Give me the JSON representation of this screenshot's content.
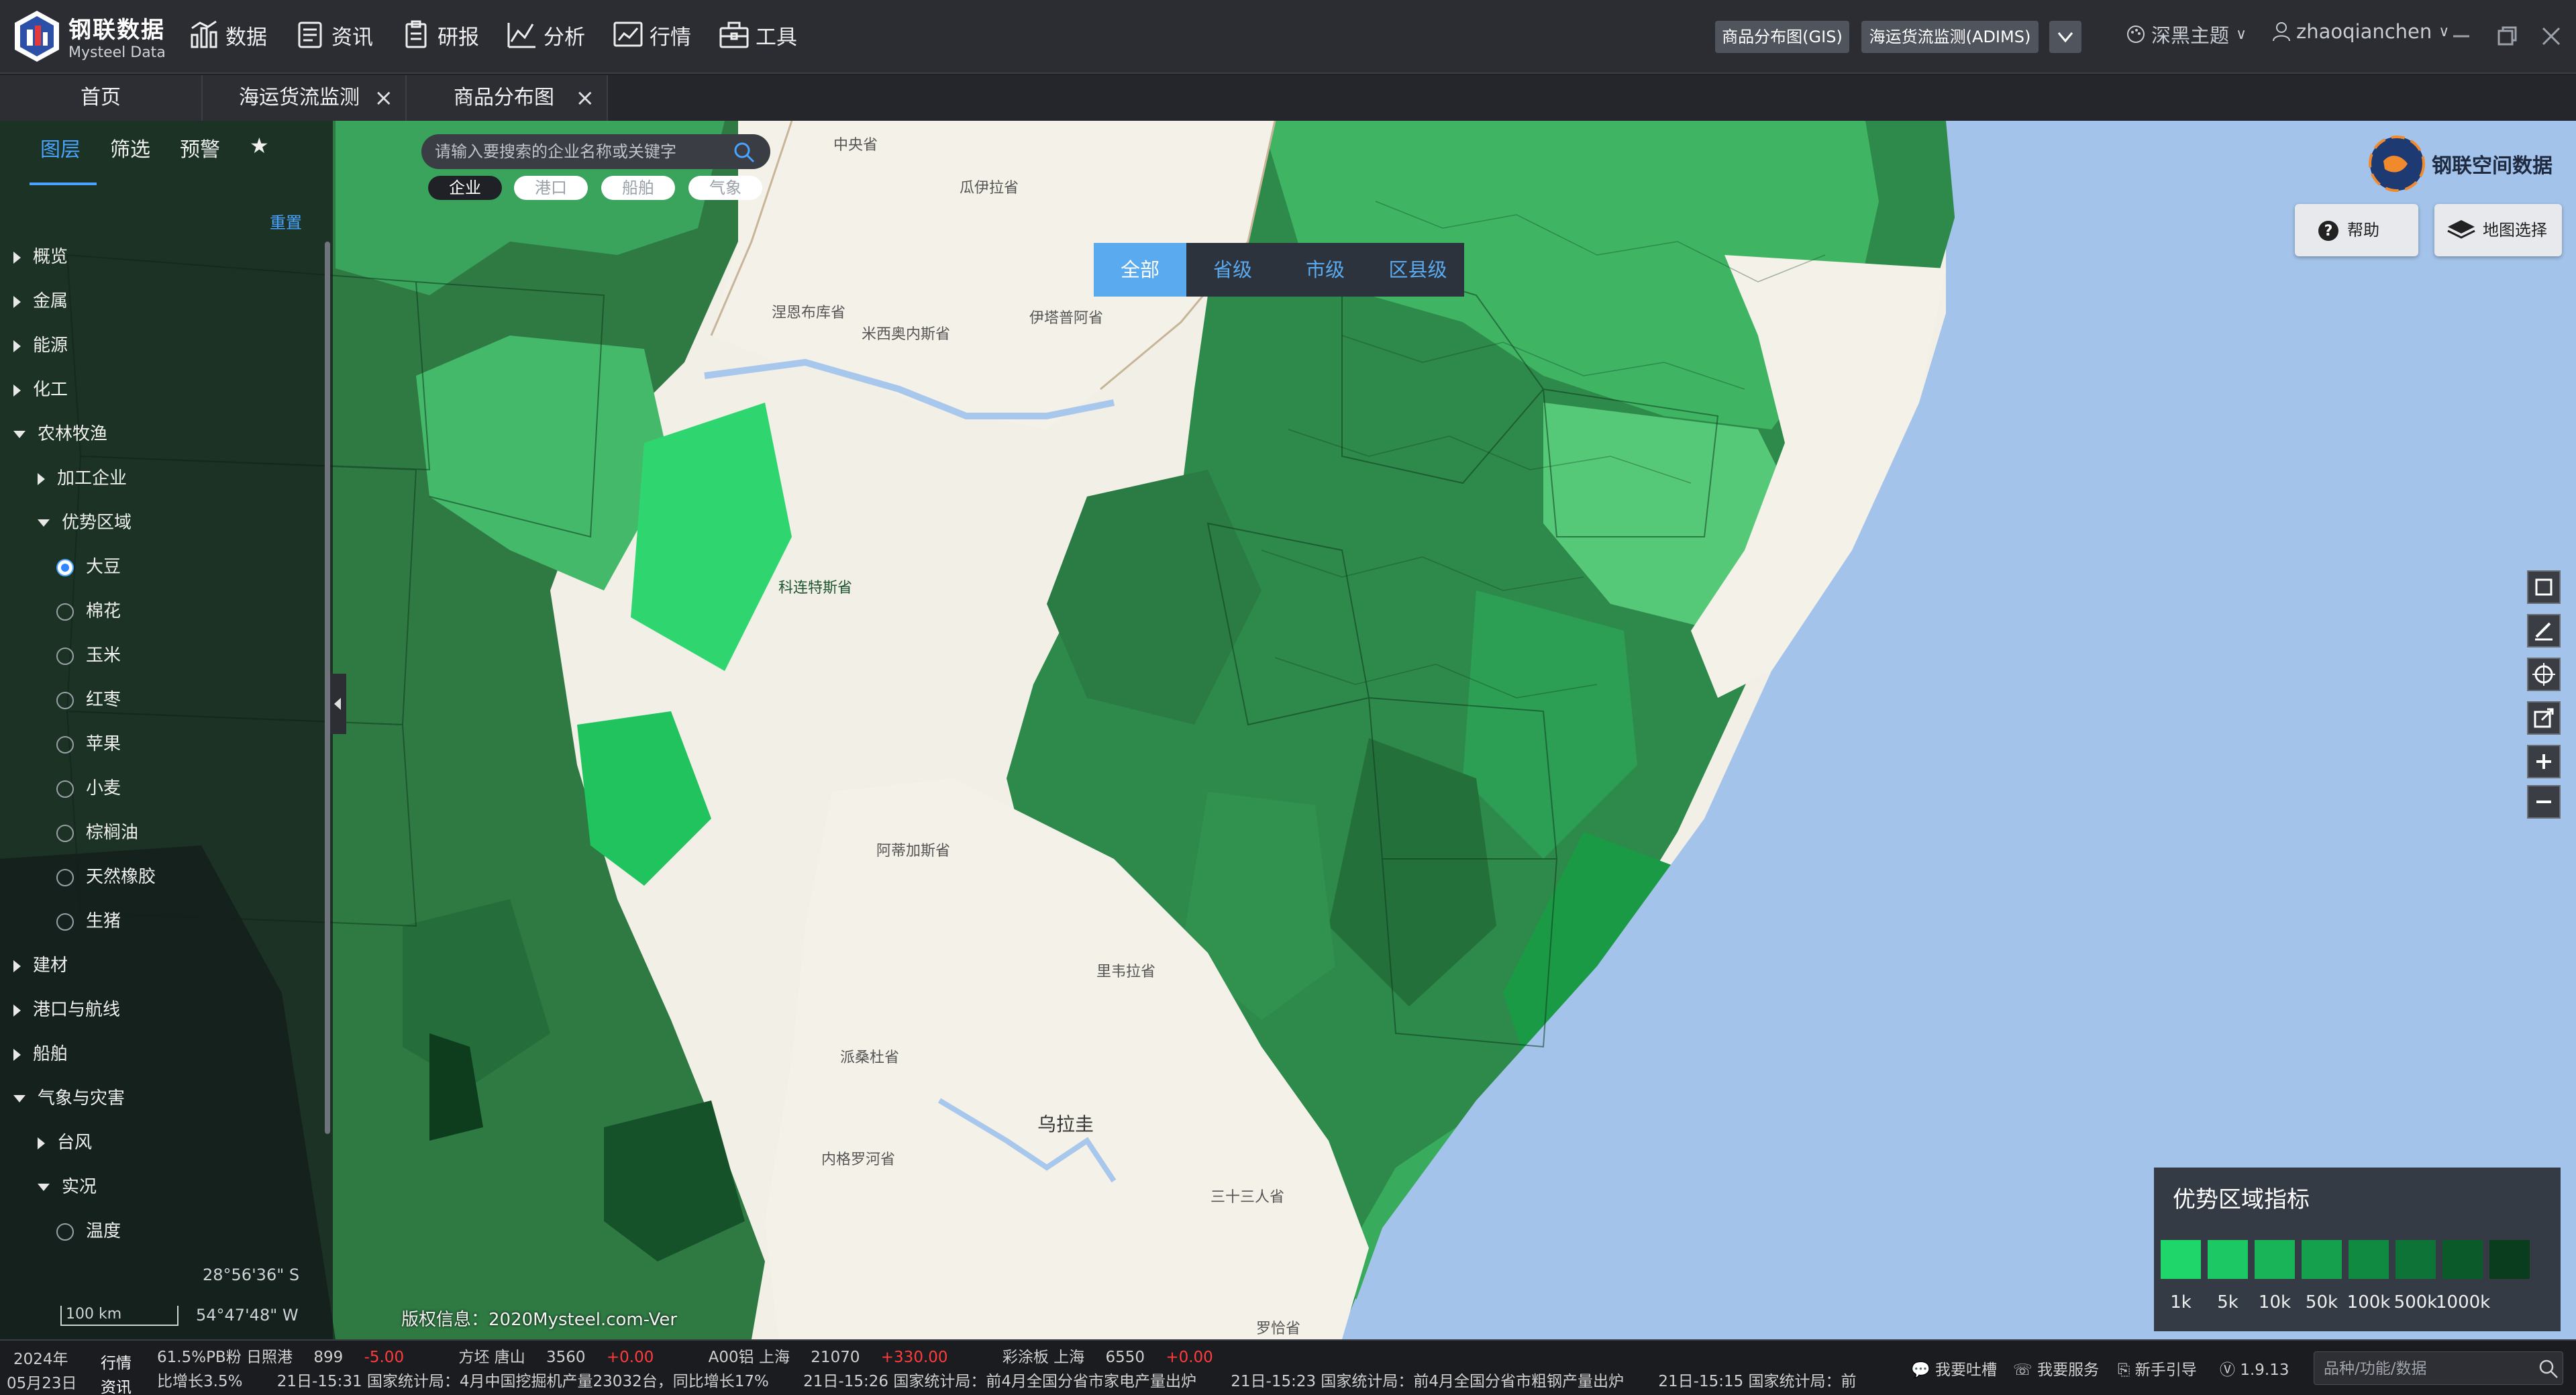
{
  "app": {
    "logo_cn": "钢联数据",
    "logo_en": "Mysteel Data",
    "nav": [
      {
        "label": "数据",
        "icon": "bar-chart-icon"
      },
      {
        "label": "资讯",
        "icon": "news-icon"
      },
      {
        "label": "研报",
        "icon": "report-icon"
      },
      {
        "label": "分析",
        "icon": "analysis-icon"
      },
      {
        "label": "行情",
        "icon": "market-icon"
      },
      {
        "label": "工具",
        "icon": "toolbox-icon"
      }
    ],
    "quick_links": [
      "商品分布图(GIS)",
      "海运货流监测(ADIMS)"
    ],
    "theme": "深黑主题",
    "user": "zhaoqianchen"
  },
  "tabs": [
    {
      "label": "首页",
      "closable": false
    },
    {
      "label": "海运货流监测",
      "closable": true
    },
    {
      "label": "商品分布图",
      "closable": true
    }
  ],
  "panel": {
    "tabs": [
      "图层",
      "筛选",
      "预警"
    ],
    "active_tab": "图层",
    "reset": "重置",
    "tree": [
      {
        "label": "概览",
        "level": 0,
        "type": "group",
        "open": false
      },
      {
        "label": "金属",
        "level": 0,
        "type": "group",
        "open": false
      },
      {
        "label": "能源",
        "level": 0,
        "type": "group",
        "open": false
      },
      {
        "label": "化工",
        "level": 0,
        "type": "group",
        "open": false
      },
      {
        "label": "农林牧渔",
        "level": 0,
        "type": "group",
        "open": true
      },
      {
        "label": "加工企业",
        "level": 1,
        "type": "group",
        "open": false
      },
      {
        "label": "优势区域",
        "level": 1,
        "type": "group",
        "open": true
      },
      {
        "label": "大豆",
        "level": 2,
        "type": "radio",
        "checked": true
      },
      {
        "label": "棉花",
        "level": 2,
        "type": "radio",
        "checked": false
      },
      {
        "label": "玉米",
        "level": 2,
        "type": "radio",
        "checked": false
      },
      {
        "label": "红枣",
        "level": 2,
        "type": "radio",
        "checked": false
      },
      {
        "label": "苹果",
        "level": 2,
        "type": "radio",
        "checked": false
      },
      {
        "label": "小麦",
        "level": 2,
        "type": "radio",
        "checked": false
      },
      {
        "label": "棕榈油",
        "level": 2,
        "type": "radio",
        "checked": false
      },
      {
        "label": "天然橡胶",
        "level": 2,
        "type": "radio",
        "checked": false
      },
      {
        "label": "生猪",
        "level": 2,
        "type": "radio",
        "checked": false
      },
      {
        "label": "建材",
        "level": 0,
        "type": "group",
        "open": false
      },
      {
        "label": "港口与航线",
        "level": 0,
        "type": "group",
        "open": false
      },
      {
        "label": "船舶",
        "level": 0,
        "type": "group",
        "open": false
      },
      {
        "label": "气象与灾害",
        "level": 0,
        "type": "group",
        "open": true
      },
      {
        "label": "台风",
        "level": 1,
        "type": "group",
        "open": false
      },
      {
        "label": "实况",
        "level": 1,
        "type": "group",
        "open": true
      },
      {
        "label": "温度",
        "level": 2,
        "type": "radio",
        "checked": false
      }
    ],
    "lat": "28°56'36\" S",
    "lon": "54°47'48\" W",
    "scale": "100 km"
  },
  "search": {
    "placeholder": "请输入要搜索的企业名称或关键字",
    "chips": [
      "企业",
      "港口",
      "船舶",
      "气象"
    ],
    "active_chip": "企业"
  },
  "levels": [
    "全部",
    "省级",
    "市级",
    "区县级"
  ],
  "active_level": "全部",
  "brand": "钢联空间数据",
  "buttons": {
    "help": "帮助",
    "map_select": "地图选择"
  },
  "tools": [
    "square-select-icon",
    "draw-icon",
    "locate-icon",
    "export-icon",
    "zoom-in-icon",
    "zoom-out-icon"
  ],
  "map_labels": [
    "中央省",
    "瓜伊拉省",
    "涅恩布库省",
    "米西奥内斯省",
    "伊塔普阿省",
    "科连特斯省",
    "阿蒂加斯省",
    "里韦拉省",
    "派桑杜省",
    "乌拉圭",
    "内格罗河省",
    "三十三人省",
    "罗恰省"
  ],
  "legend": {
    "title": "优势区域指标",
    "items": [
      {
        "label": "1k",
        "color": "#1fd66a"
      },
      {
        "label": "5k",
        "color": "#1cc863"
      },
      {
        "label": "10k",
        "color": "#18b457"
      },
      {
        "label": "50k",
        "color": "#14a04c"
      },
      {
        "label": "100k",
        "color": "#108a41"
      },
      {
        "label": "500k",
        "color": "#0d7336"
      },
      {
        "label": "1000k",
        "color": "#0a5a2a"
      },
      {
        "label": "",
        "color": "#0a3d1e"
      }
    ]
  },
  "copyright": "版权信息：2020Mysteel.com-Ver",
  "ticker": {
    "date_year": "2024年",
    "date_day": "05月23日",
    "row1_tag": "行情",
    "row1": [
      {
        "text": "61.5%PB粉 日照港",
        "value": "899",
        "change": "-5.00"
      },
      {
        "text": "方坯 唐山",
        "value": "3560",
        "change": "+0.00"
      },
      {
        "text": "A00铝 上海",
        "value": "21070",
        "change": "+330.00"
      },
      {
        "text": "彩涂板 上海",
        "value": "6550",
        "change": "+0.00"
      }
    ],
    "row2_tag": "资讯",
    "row2": [
      "比增长3.5%",
      "21日-15:31 国家统计局：4月中国挖掘机产量23032台，同比增长17%",
      "21日-15:26 国家统计局：前4月全国分省市家电产量出炉",
      "21日-15:23 国家统计局：前4月全国分省市粗钢产量出炉",
      "21日-15:15 国家统计局：前"
    ],
    "links": [
      "我要吐槽",
      "我要服务",
      "新手引导",
      "1.9.13"
    ],
    "search_placeholder": "品种/功能/数据"
  }
}
